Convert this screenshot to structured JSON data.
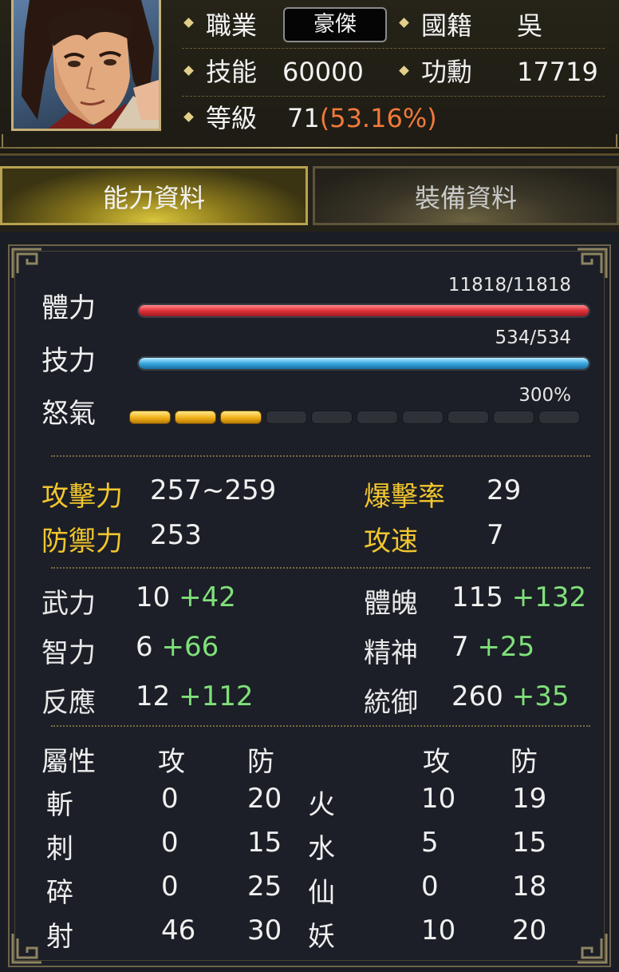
{
  "header": {
    "job_label": "職業",
    "job_value": "豪傑",
    "nation_label": "國籍",
    "nation_value": "吳",
    "skill_label": "技能",
    "skill_value": "60000",
    "merit_label": "功勳",
    "merit_value": "17719",
    "level_label": "等級",
    "level_value": "71",
    "level_percent": "(53.16%)"
  },
  "tabs": [
    {
      "label": "能力資料",
      "active": true
    },
    {
      "label": "裝備資料",
      "active": false
    }
  ],
  "bars": {
    "hp": {
      "label": "體力",
      "text": "11818/11818",
      "fraction": 1.0
    },
    "mp": {
      "label": "技力",
      "text": "534/534",
      "fraction": 1.0
    },
    "rage": {
      "label": "怒氣",
      "text": "300%",
      "segments_total": 10,
      "segments_filled": 3
    }
  },
  "combat": {
    "attack_label": "攻擊力",
    "attack_value": "257~259",
    "crit_label": "爆擊率",
    "crit_value": "29",
    "defense_label": "防禦力",
    "defense_value": "253",
    "speed_label": "攻速",
    "speed_value": "7"
  },
  "attributes": [
    {
      "label": "武力",
      "base": "10",
      "bonus": "+42"
    },
    {
      "label": "體魄",
      "base": "115",
      "bonus": "+132"
    },
    {
      "label": "智力",
      "base": "6",
      "bonus": "+66"
    },
    {
      "label": "精神",
      "base": "7",
      "bonus": "+25"
    },
    {
      "label": "反應",
      "base": "12",
      "bonus": "+112"
    },
    {
      "label": "統御",
      "base": "260",
      "bonus": "+35"
    }
  ],
  "elements": {
    "header": {
      "attr": "屬性",
      "atk": "攻",
      "def": "防",
      "atk2": "攻",
      "def2": "防"
    },
    "rows": [
      {
        "n1": "斬",
        "a1": "0",
        "d1": "20",
        "n2": "火",
        "a2": "10",
        "d2": "19"
      },
      {
        "n1": "刺",
        "a1": "0",
        "d1": "15",
        "n2": "水",
        "a2": "5",
        "d2": "15"
      },
      {
        "n1": "碎",
        "a1": "0",
        "d1": "25",
        "n2": "仙",
        "a2": "0",
        "d2": "18"
      },
      {
        "n1": "射",
        "a1": "46",
        "d1": "30",
        "n2": "妖",
        "a2": "10",
        "d2": "20"
      }
    ]
  },
  "colors": {
    "accent_gold": "#f2c62e",
    "bonus_green": "#7fe07a",
    "level_percent": "#f07a3a",
    "hp": "#e0303a",
    "mp": "#38a8e0"
  }
}
